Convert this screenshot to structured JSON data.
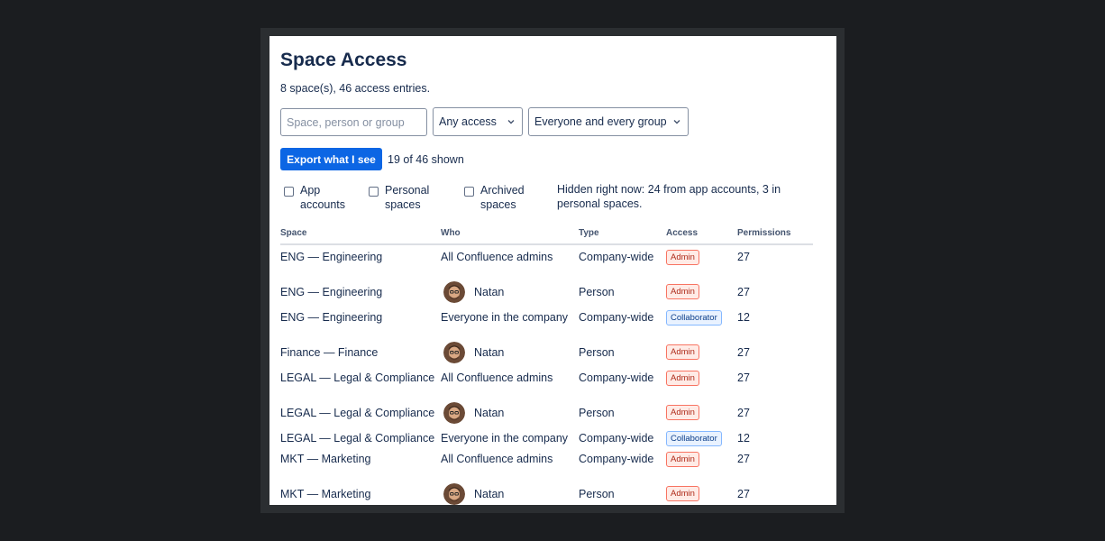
{
  "page": {
    "title": "Space Access",
    "summary": "8 space(s), 46 access entries."
  },
  "filters": {
    "search_placeholder": "Space, person or group",
    "access_select": "Any access",
    "group_select": "Everyone and every group"
  },
  "toolbar": {
    "export_label": "Export what I see",
    "shown_text": "19 of 46 shown"
  },
  "toggles": [
    {
      "label": "App accounts",
      "checked": false
    },
    {
      "label": "Personal spaces",
      "checked": false
    },
    {
      "label": "Archived spaces",
      "checked": false
    }
  ],
  "hidden_note": "Hidden right now: 24 from app accounts, 3 in personal spaces.",
  "table": {
    "columns": [
      "Space",
      "Who",
      "Type",
      "Access",
      "Permissions"
    ],
    "rows": [
      {
        "space": "ENG — Engineering",
        "who": "All Confluence admins",
        "avatar": false,
        "type": "Company-wide",
        "access": "Admin",
        "permissions": "27"
      },
      {
        "space": "ENG — Engineering",
        "who": "Natan",
        "avatar": true,
        "type": "Person",
        "access": "Admin",
        "permissions": "27"
      },
      {
        "space": "ENG — Engineering",
        "who": "Everyone in the company",
        "avatar": false,
        "type": "Company-wide",
        "access": "Collaborator",
        "permissions": "12"
      },
      {
        "space": "Finance — Finance",
        "who": "Natan",
        "avatar": true,
        "type": "Person",
        "access": "Admin",
        "permissions": "27"
      },
      {
        "space": "LEGAL — Legal & Compliance",
        "who": "All Confluence admins",
        "avatar": false,
        "type": "Company-wide",
        "access": "Admin",
        "permissions": "27"
      },
      {
        "space": "LEGAL — Legal & Compliance",
        "who": "Natan",
        "avatar": true,
        "type": "Person",
        "access": "Admin",
        "permissions": "27"
      },
      {
        "space": "LEGAL — Legal & Compliance",
        "who": "Everyone in the company",
        "avatar": false,
        "type": "Company-wide",
        "access": "Collaborator",
        "permissions": "12"
      },
      {
        "space": "MKT — Marketing",
        "who": "All Confluence admins",
        "avatar": false,
        "type": "Company-wide",
        "access": "Admin",
        "permissions": "27"
      },
      {
        "space": "MKT — Marketing",
        "who": "Natan",
        "avatar": true,
        "type": "Person",
        "access": "Admin",
        "permissions": "27"
      }
    ]
  },
  "colors": {
    "accent": "#0c66e4",
    "admin_bg": "#ffebe6",
    "admin_text": "#ae2a19",
    "collaborator_bg": "#e9f2ff",
    "collaborator_text": "#0c3e8a"
  }
}
